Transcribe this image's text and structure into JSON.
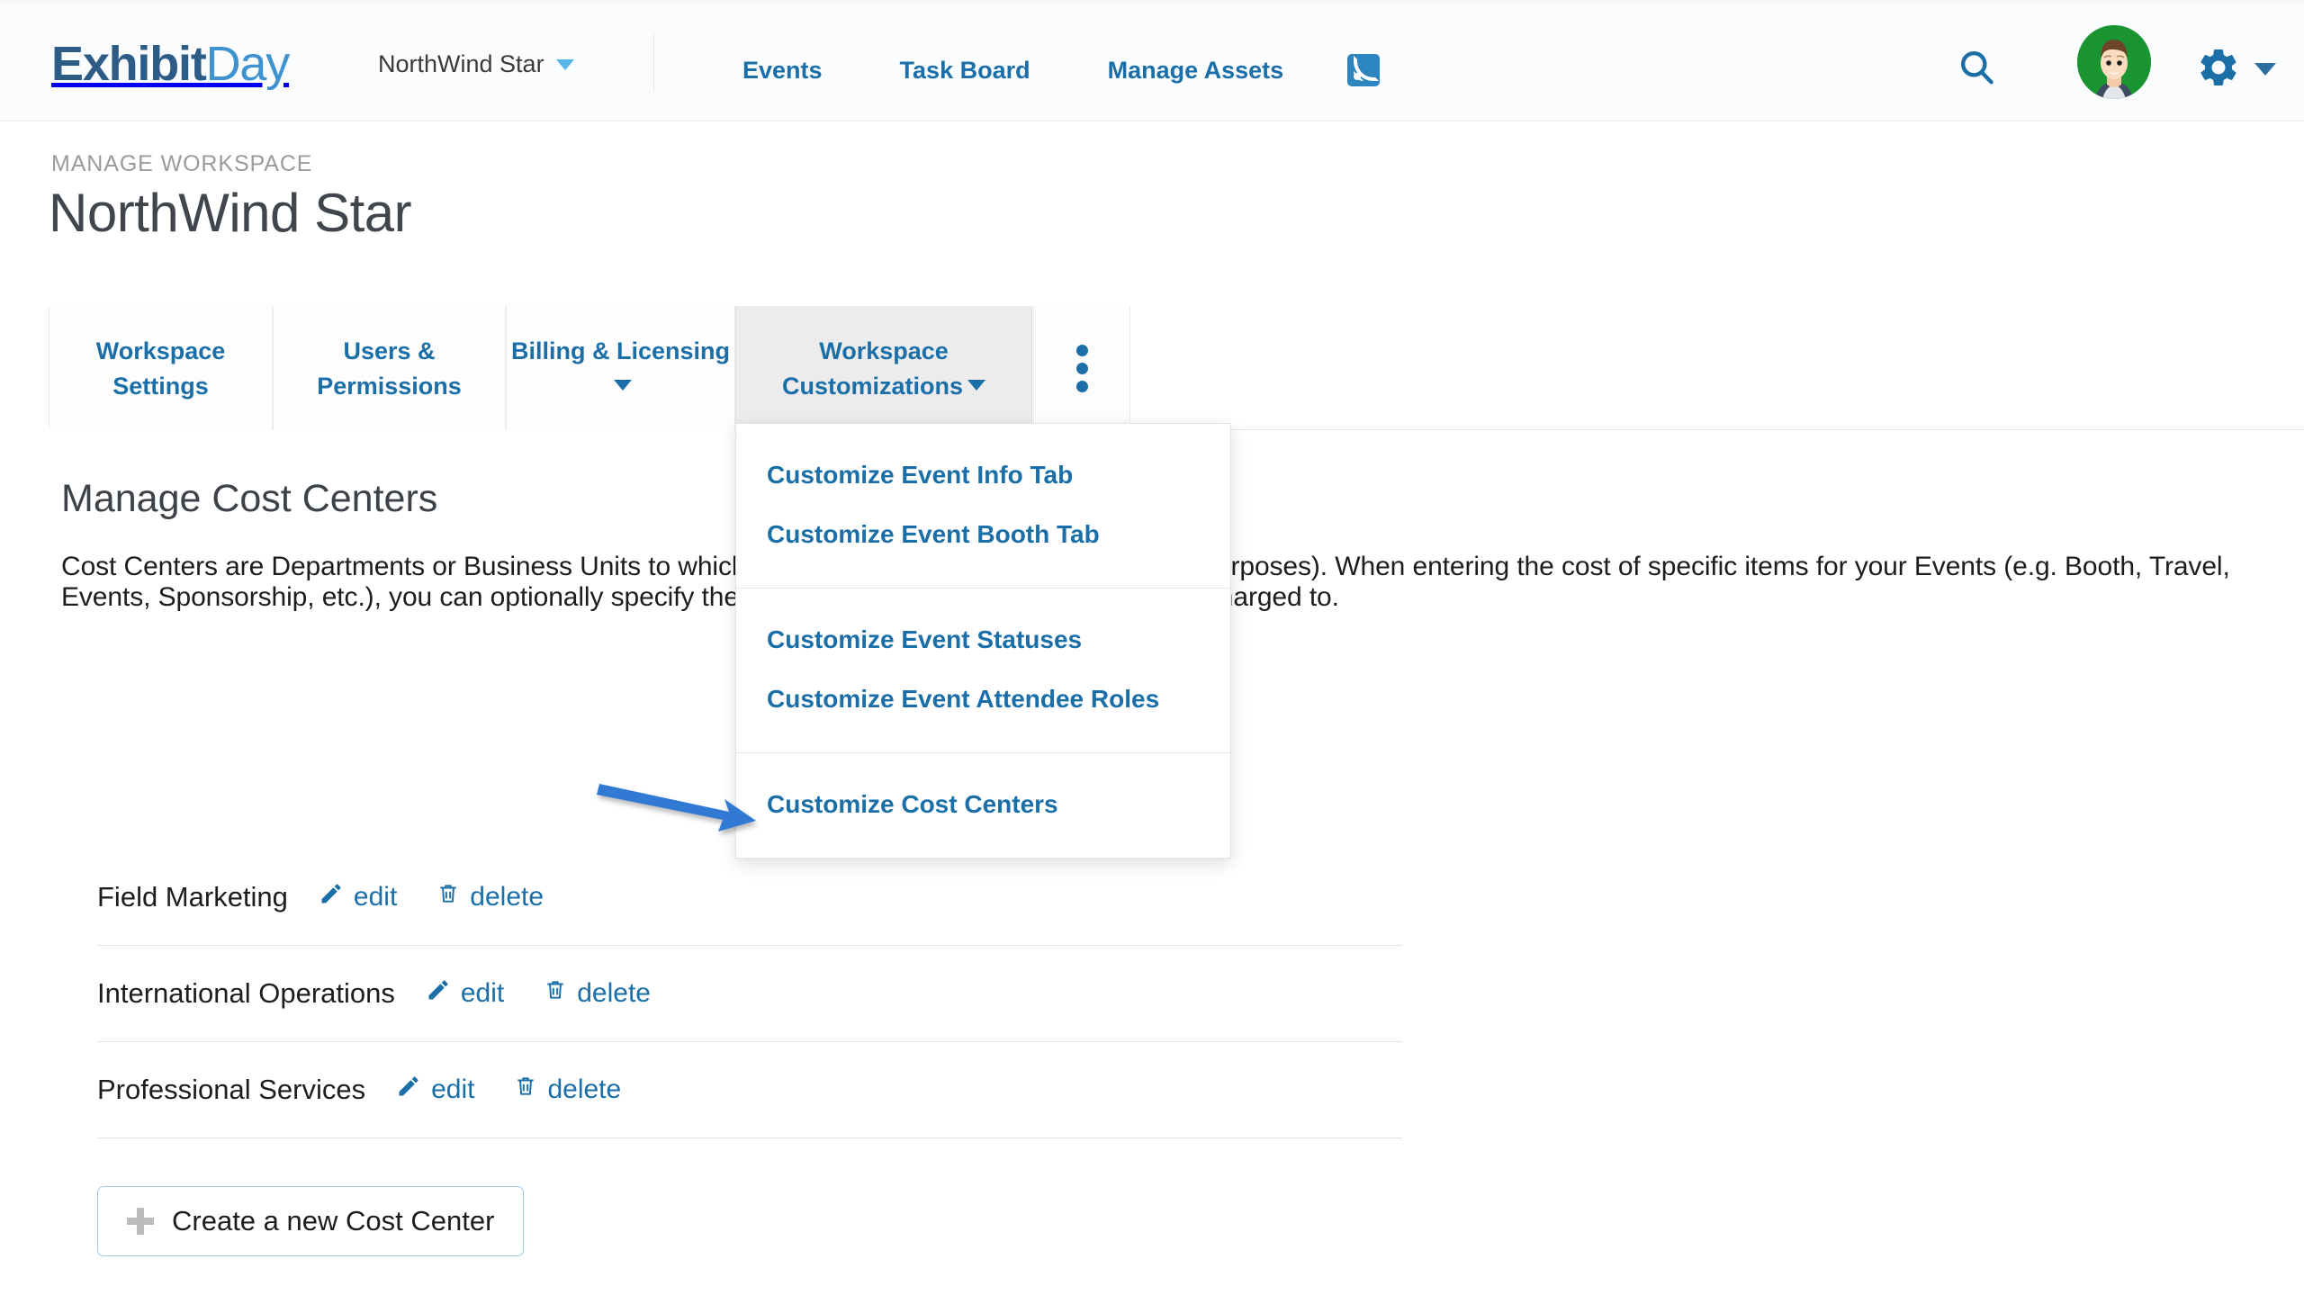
{
  "header": {
    "logo_part1": "Exhibit",
    "logo_part2": "Day",
    "workspace_name": "NorthWind Star",
    "nav": [
      {
        "label": "Events"
      },
      {
        "label": "Task Board"
      },
      {
        "label": "Manage Assets"
      }
    ],
    "rss_icon": "rss-feed-icon",
    "search_icon": "search-icon",
    "gear_icon": "gear-icon",
    "avatar": "user-avatar",
    "accent_blue": "#1a6fa8",
    "avatar_bg": "#1a9431"
  },
  "page": {
    "eyebrow": "MANAGE WORKSPACE",
    "title": "NorthWind Star"
  },
  "tabs": [
    {
      "label": "Workspace Settings",
      "has_caret": false,
      "active": false
    },
    {
      "label": "Users & Permissions",
      "has_caret": false,
      "active": false
    },
    {
      "label": "Billing & Licensing",
      "has_caret": true,
      "active": false
    },
    {
      "label": "Workspace Customizations",
      "has_caret": true,
      "active": true
    }
  ],
  "tab_overflow": "more-options-kebab",
  "dropdown": {
    "sections": [
      {
        "items": [
          {
            "label": "Customize Event Info Tab"
          },
          {
            "label": "Customize Event Booth Tab"
          }
        ]
      },
      {
        "items": [
          {
            "label": "Customize Event Statuses"
          },
          {
            "label": "Customize Event Attendee Roles"
          }
        ]
      },
      {
        "items": [
          {
            "label": "Customize Cost Centers"
          }
        ]
      }
    ]
  },
  "main": {
    "heading": "Manage Cost Centers",
    "description": "Cost Centers are Departments or Business Units to which costs can be charged (for accounting purposes). When entering the cost of specific items for your Events (e.g. Booth, Travel, Events, Sponsorship, etc.), you can optionally specify the Cost Center(s) that the cost should be charged to.",
    "cost_centers": [
      {
        "name": "Field Marketing",
        "edit_label": "edit",
        "delete_label": "delete"
      },
      {
        "name": "International Operations",
        "edit_label": "edit",
        "delete_label": "delete"
      },
      {
        "name": "Professional Services",
        "edit_label": "edit",
        "delete_label": "delete"
      }
    ],
    "create_button": "Create a new Cost Center"
  },
  "annotation": {
    "arrow_color": "#3279d4",
    "points_to": "Customize Cost Centers"
  }
}
